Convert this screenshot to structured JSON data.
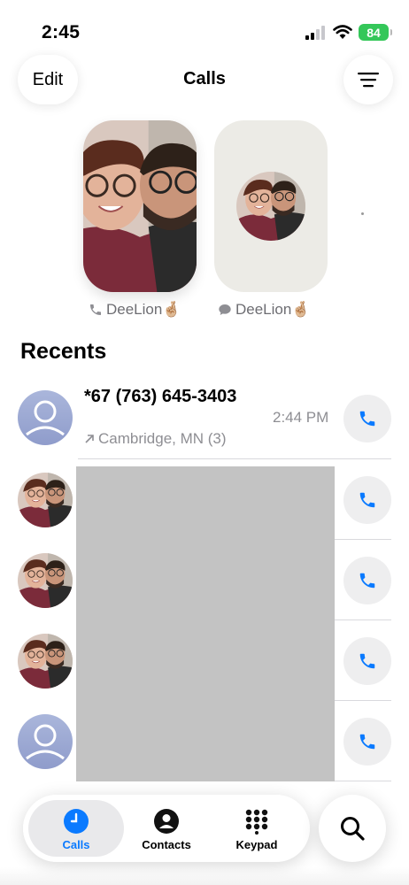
{
  "status_bar": {
    "time": "2:45",
    "battery": "84"
  },
  "header": {
    "edit_label": "Edit",
    "title": "Calls"
  },
  "favorites": [
    {
      "name": "DeeLion🤞🏼",
      "type_icon": "phone-icon"
    },
    {
      "name": "DeeLion🤞🏼",
      "type_icon": "message-icon"
    }
  ],
  "recents": {
    "title": "Recents",
    "first_call": {
      "name": "*67 (763) 645-3403",
      "location": "Cambridge, MN (3)",
      "time": "2:44 PM",
      "direction_icon": "outgoing-arrow-icon"
    }
  },
  "tab_bar": {
    "tabs": [
      {
        "label": "Calls",
        "icon": "clock-icon",
        "selected": true
      },
      {
        "label": "Contacts",
        "icon": "person-circle-icon",
        "selected": false
      },
      {
        "label": "Keypad",
        "icon": "keypad-icon",
        "selected": false
      }
    ],
    "search_icon": "search-icon"
  },
  "colors": {
    "accent": "#0a7aff",
    "battery": "#34c759",
    "redaction": "#c3c3c3"
  }
}
